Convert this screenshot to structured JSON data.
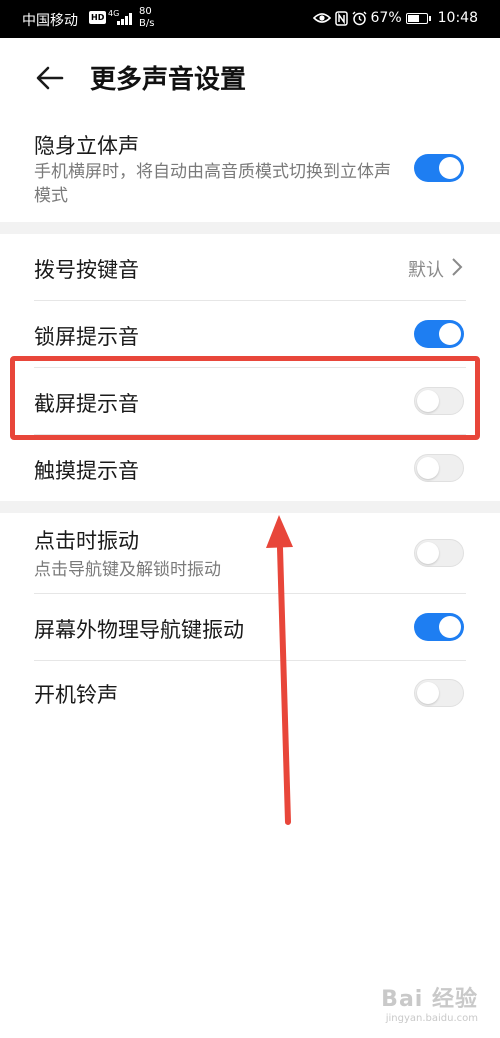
{
  "status_bar": {
    "carrier": "中国移动",
    "hd_badge": "HD",
    "network": "4G",
    "speed_value": "80",
    "speed_unit": "B/s",
    "battery": "67%",
    "time": "10:48",
    "battery_level": 0.67
  },
  "header": {
    "title": "更多声音设置",
    "back_icon": "back-arrow-icon"
  },
  "settings": {
    "stereo": {
      "label": "隐身立体声",
      "description": "手机横屏时，将自动由高音质模式切换到立体声模式",
      "on": true
    },
    "dial_tone": {
      "label": "拨号按键音",
      "value": "默认"
    },
    "lock_sound": {
      "label": "锁屏提示音",
      "on": true
    },
    "screenshot_sound": {
      "label": "截屏提示音",
      "on": false
    },
    "touch_sound": {
      "label": "触摸提示音",
      "on": false
    },
    "vibrate_click": {
      "label": "点击时振动",
      "description": "点击导航键及解锁时振动",
      "on": false
    },
    "nav_vibrate": {
      "label": "屏幕外物理导航键振动",
      "on": true
    },
    "boot_ringtone": {
      "label": "开机铃声",
      "on": false
    }
  },
  "colors": {
    "accent": "#1e7ef2",
    "highlight": "#e8463a"
  },
  "watermark": {
    "line1": "Bai 经验",
    "line2": "jingyan.baidu.com"
  }
}
